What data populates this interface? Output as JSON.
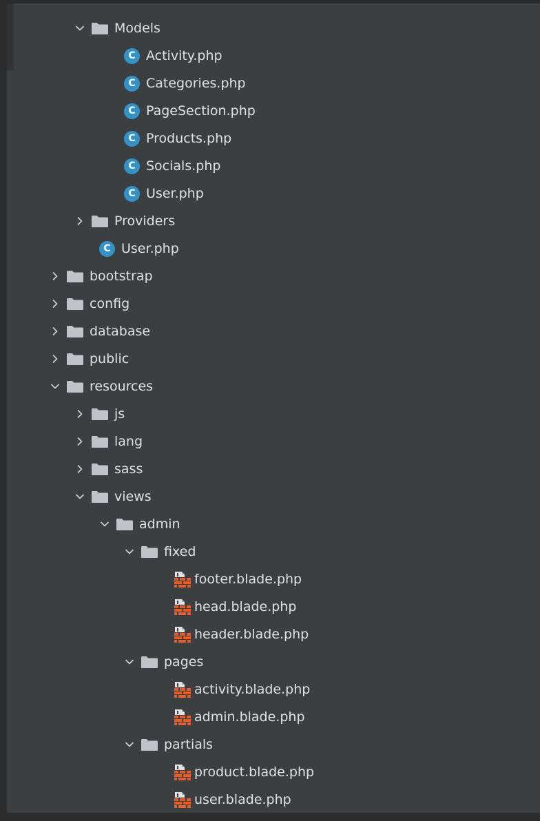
{
  "colors": {
    "background": "#3c3f41",
    "text": "#dfe1e5",
    "folder": "#c0c3c7",
    "class_icon": "#3592c4",
    "blade_icon": "#e85d26"
  },
  "tree": {
    "models": {
      "label": "Models",
      "expanded": true,
      "icon": "folder-icon"
    },
    "activity": {
      "label": "Activity.php",
      "icon": "php-class-icon"
    },
    "categories": {
      "label": "Categories.php",
      "icon": "php-class-icon"
    },
    "pagesection": {
      "label": "PageSection.php",
      "icon": "php-class-icon"
    },
    "products": {
      "label": "Products.php",
      "icon": "php-class-icon"
    },
    "socials": {
      "label": "Socials.php",
      "icon": "php-class-icon"
    },
    "models_user": {
      "label": "User.php",
      "icon": "php-class-icon"
    },
    "providers": {
      "label": "Providers",
      "expanded": false,
      "icon": "folder-icon"
    },
    "app_user": {
      "label": "User.php",
      "icon": "php-class-icon"
    },
    "bootstrap": {
      "label": "bootstrap",
      "expanded": false,
      "icon": "folder-icon"
    },
    "config": {
      "label": "config",
      "expanded": false,
      "icon": "folder-icon"
    },
    "database": {
      "label": "database",
      "expanded": false,
      "icon": "folder-icon"
    },
    "public": {
      "label": "public",
      "expanded": false,
      "icon": "folder-icon"
    },
    "resources": {
      "label": "resources",
      "expanded": true,
      "icon": "folder-icon"
    },
    "js": {
      "label": "js",
      "expanded": false,
      "icon": "folder-icon"
    },
    "lang": {
      "label": "lang",
      "expanded": false,
      "icon": "folder-icon"
    },
    "sass": {
      "label": "sass",
      "expanded": false,
      "icon": "folder-icon"
    },
    "views": {
      "label": "views",
      "expanded": true,
      "icon": "folder-icon"
    },
    "admin": {
      "label": "admin",
      "expanded": true,
      "icon": "folder-icon"
    },
    "fixed": {
      "label": "fixed",
      "expanded": true,
      "icon": "folder-icon"
    },
    "footer": {
      "label": "footer.blade.php",
      "icon": "blade-file-icon"
    },
    "head": {
      "label": "head.blade.php",
      "icon": "blade-file-icon"
    },
    "header": {
      "label": "header.blade.php",
      "icon": "blade-file-icon"
    },
    "pages": {
      "label": "pages",
      "expanded": true,
      "icon": "folder-icon"
    },
    "activity_blade": {
      "label": "activity.blade.php",
      "icon": "blade-file-icon"
    },
    "admin_blade": {
      "label": "admin.blade.php",
      "icon": "blade-file-icon"
    },
    "partials": {
      "label": "partials",
      "expanded": true,
      "icon": "folder-icon"
    },
    "product_blade": {
      "label": "product.blade.php",
      "icon": "blade-file-icon"
    },
    "user_blade": {
      "label": "user.blade.php",
      "icon": "blade-file-icon"
    }
  }
}
